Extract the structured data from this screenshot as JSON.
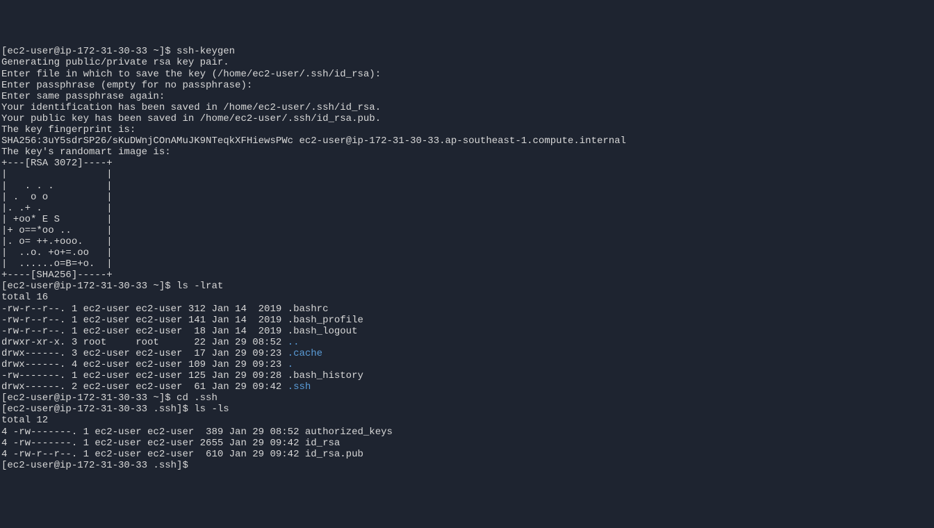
{
  "prompt1": "[ec2-user@ip-172-31-30-33 ~]$ ",
  "cmd1": "ssh-keygen",
  "out1_l1": "Generating public/private rsa key pair.",
  "out1_l2": "Enter file in which to save the key (/home/ec2-user/.ssh/id_rsa):",
  "out1_l3": "Enter passphrase (empty for no passphrase):",
  "out1_l4": "Enter same passphrase again:",
  "out1_l5": "Your identification has been saved in /home/ec2-user/.ssh/id_rsa.",
  "out1_l6": "Your public key has been saved in /home/ec2-user/.ssh/id_rsa.pub.",
  "out1_l7": "The key fingerprint is:",
  "out1_l8": "SHA256:3uY5sdrSP26/sKuDWnjCOnAMuJK9NTeqkXFHiewsPWc ec2-user@ip-172-31-30-33.ap-southeast-1.compute.internal",
  "out1_l9": "The key's randomart image is:",
  "art_l1": "+---[RSA 3072]----+",
  "art_l2": "|                 |",
  "art_l3": "|   . . .         |",
  "art_l4": "| .  o o          |",
  "art_l5": "|. .+ .           |",
  "art_l6": "| +oo* E S        |",
  "art_l7": "|+ o==*oo ..      |",
  "art_l8": "|. o= ++.+ooo.    |",
  "art_l9": "|  ..o. +o+=.oo   |",
  "art_l10": "|  ......o=B=+o.  |",
  "art_l11": "+----[SHA256]-----+",
  "prompt2": "[ec2-user@ip-172-31-30-33 ~]$ ",
  "cmd2": "ls -lrat",
  "out2_l1": "total 16",
  "out2_l2": "-rw-r--r--. 1 ec2-user ec2-user 312 Jan 14  2019 .bashrc",
  "out2_l3": "-rw-r--r--. 1 ec2-user ec2-user 141 Jan 14  2019 .bash_profile",
  "out2_l4": "-rw-r--r--. 1 ec2-user ec2-user  18 Jan 14  2019 .bash_logout",
  "out2_l5a": "drwxr-xr-x. 3 root     root      22 Jan 29 08:52 ",
  "out2_l5b": "..",
  "out2_l6a": "drwx------. 3 ec2-user ec2-user  17 Jan 29 09:23 ",
  "out2_l6b": ".cache",
  "out2_l7a": "drwx------. 4 ec2-user ec2-user 109 Jan 29 09:23 ",
  "out2_l7b": ".",
  "out2_l8": "-rw-------. 1 ec2-user ec2-user 125 Jan 29 09:28 .bash_history",
  "out2_l9a": "drwx------. 2 ec2-user ec2-user  61 Jan 29 09:42 ",
  "out2_l9b": ".ssh",
  "prompt3": "[ec2-user@ip-172-31-30-33 ~]$ ",
  "cmd3": "cd .ssh",
  "prompt4": "[ec2-user@ip-172-31-30-33 .ssh]$ ",
  "cmd4": "ls -ls",
  "out4_l1": "total 12",
  "out4_l2": "4 -rw-------. 1 ec2-user ec2-user  389 Jan 29 08:52 authorized_keys",
  "out4_l3": "4 -rw-------. 1 ec2-user ec2-user 2655 Jan 29 09:42 id_rsa",
  "out4_l4": "4 -rw-r--r--. 1 ec2-user ec2-user  610 Jan 29 09:42 id_rsa.pub",
  "prompt5": "[ec2-user@ip-172-31-30-33 .ssh]$ "
}
